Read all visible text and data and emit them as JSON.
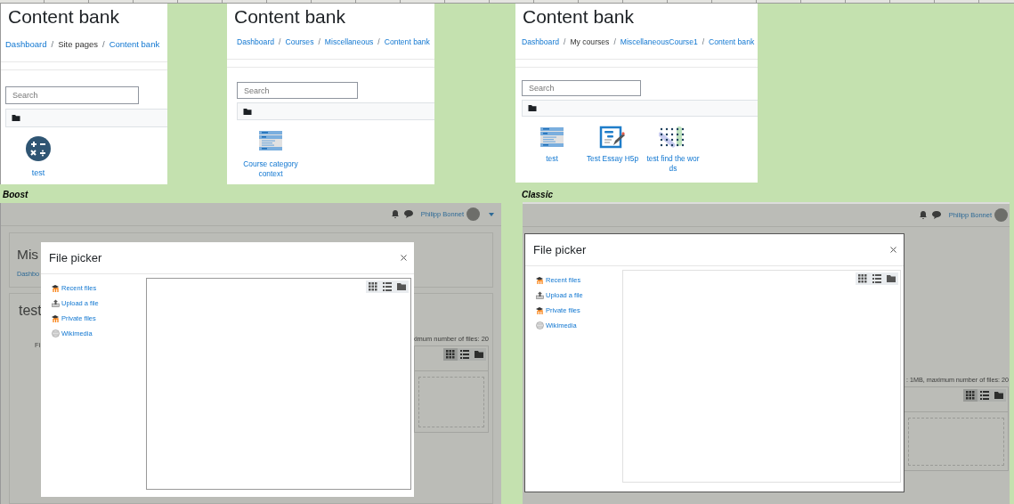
{
  "content_bank_pages": [
    {
      "title": "Content bank",
      "separator": "/",
      "breadcrumb": [
        {
          "text": "Dashboard",
          "link": true
        },
        {
          "text": "Site pages",
          "link": false
        },
        {
          "text": "Content bank",
          "link": true
        }
      ],
      "search": {
        "placeholder": "Search"
      },
      "items": [
        {
          "label": "test",
          "kind": "calculator"
        }
      ]
    },
    {
      "title": "Content bank",
      "separator": "/",
      "breadcrumb": [
        {
          "text": "Dashboard",
          "link": true
        },
        {
          "text": "Courses",
          "link": true
        },
        {
          "text": "Miscellaneous",
          "link": true
        },
        {
          "text": "Content bank",
          "link": true
        }
      ],
      "search": {
        "placeholder": "Search"
      },
      "items": [
        {
          "label": "Course category context",
          "kind": "list"
        }
      ]
    },
    {
      "title": "Content bank",
      "separator": "/",
      "breadcrumb": [
        {
          "text": "Dashboard",
          "link": true
        },
        {
          "text": "My courses",
          "link": false
        },
        {
          "text": "MiscellaneousCourse1",
          "link": true
        },
        {
          "text": "Content bank",
          "link": true
        }
      ],
      "search": {
        "placeholder": "Search"
      },
      "items": [
        {
          "label": "test",
          "kind": "list"
        },
        {
          "label": "Test Essay H5p",
          "kind": "essay"
        },
        {
          "label": "test find the words",
          "kind": "words"
        }
      ]
    }
  ],
  "themes": [
    {
      "label": "Boost",
      "user": "Philipp Bonnet",
      "page_heading": "Mis",
      "page_breadcrumb": "Dashbo",
      "section_title": "test",
      "field_label": "Fi",
      "file_limits": "ximum number of files: 20",
      "file_picker": {
        "title": "File picker",
        "repositories": [
          {
            "label": "Recent files",
            "kind": "moodle"
          },
          {
            "label": "Upload a file",
            "kind": "upload"
          },
          {
            "label": "Private files",
            "kind": "moodle"
          },
          {
            "label": "Wikimedia",
            "kind": "wiki"
          }
        ]
      }
    },
    {
      "label": "Classic",
      "user": "Philipp Bonnet",
      "file_limits": ": 1MB, maximum number of files: 20",
      "file_picker": {
        "title": "File picker",
        "repositories": [
          {
            "label": "Recent files",
            "kind": "moodle"
          },
          {
            "label": "Upload a file",
            "kind": "upload"
          },
          {
            "label": "Private files",
            "kind": "moodle"
          },
          {
            "label": "Wikimedia",
            "kind": "wiki"
          }
        ]
      }
    }
  ]
}
